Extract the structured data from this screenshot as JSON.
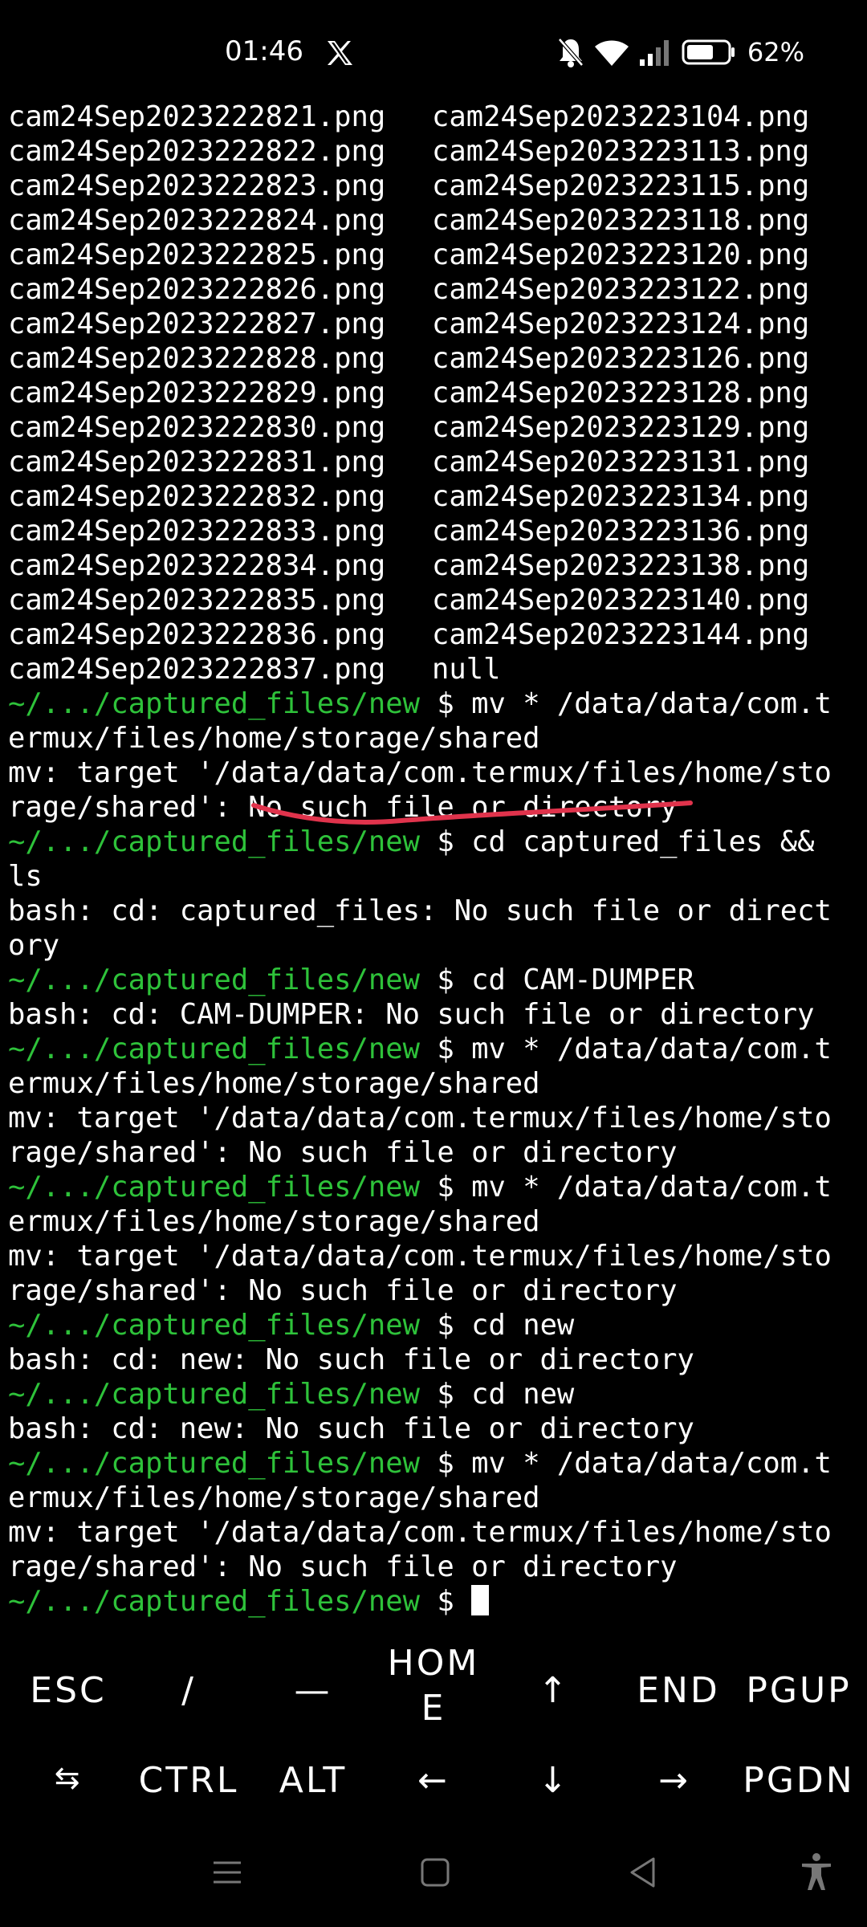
{
  "status_bar": {
    "time": "01:46",
    "battery_text": "62%",
    "icons": [
      "x-app-icon",
      "mute-icon",
      "wifi-icon",
      "signal-icon",
      "battery-icon"
    ]
  },
  "terminal": {
    "listing": [
      [
        "cam24Sep2023222821.png",
        "cam24Sep2023223104.png"
      ],
      [
        "cam24Sep2023222822.png",
        "cam24Sep2023223113.png"
      ],
      [
        "cam24Sep2023222823.png",
        "cam24Sep2023223115.png"
      ],
      [
        "cam24Sep2023222824.png",
        "cam24Sep2023223118.png"
      ],
      [
        "cam24Sep2023222825.png",
        "cam24Sep2023223120.png"
      ],
      [
        "cam24Sep2023222826.png",
        "cam24Sep2023223122.png"
      ],
      [
        "cam24Sep2023222827.png",
        "cam24Sep2023223124.png"
      ],
      [
        "cam24Sep2023222828.png",
        "cam24Sep2023223126.png"
      ],
      [
        "cam24Sep2023222829.png",
        "cam24Sep2023223128.png"
      ],
      [
        "cam24Sep2023222830.png",
        "cam24Sep2023223129.png"
      ],
      [
        "cam24Sep2023222831.png",
        "cam24Sep2023223131.png"
      ],
      [
        "cam24Sep2023222832.png",
        "cam24Sep2023223134.png"
      ],
      [
        "cam24Sep2023222833.png",
        "cam24Sep2023223136.png"
      ],
      [
        "cam24Sep2023222834.png",
        "cam24Sep2023223138.png"
      ],
      [
        "cam24Sep2023222835.png",
        "cam24Sep2023223140.png"
      ],
      [
        "cam24Sep2023222836.png",
        "cam24Sep2023223144.png"
      ],
      [
        "cam24Sep2023222837.png",
        "null"
      ]
    ],
    "prompt": "~/.../captured_files/new",
    "lines": [
      {
        "type": "cmd",
        "text": " $ mv * /data/data/com.t"
      },
      {
        "type": "out",
        "text": "ermux/files/home/storage/shared"
      },
      {
        "type": "out",
        "text": "mv: target '/data/data/com.termux/files/home/sto"
      },
      {
        "type": "out",
        "text": "rage/shared': No such file or directory"
      },
      {
        "type": "cmd",
        "text": " $ cd captured_files &&"
      },
      {
        "type": "out",
        "text": "ls"
      },
      {
        "type": "out",
        "text": "bash: cd: captured_files: No such file or direct"
      },
      {
        "type": "out",
        "text": "ory"
      },
      {
        "type": "cmd",
        "text": " $ cd CAM-DUMPER"
      },
      {
        "type": "out",
        "text": "bash: cd: CAM-DUMPER: No such file or directory"
      },
      {
        "type": "cmd",
        "text": " $ mv * /data/data/com.t"
      },
      {
        "type": "out",
        "text": "ermux/files/home/storage/shared"
      },
      {
        "type": "out",
        "text": "mv: target '/data/data/com.termux/files/home/sto"
      },
      {
        "type": "out",
        "text": "rage/shared': No such file or directory"
      },
      {
        "type": "cmd",
        "text": " $ mv * /data/data/com.t"
      },
      {
        "type": "out",
        "text": "ermux/files/home/storage/shared"
      },
      {
        "type": "out",
        "text": "mv: target '/data/data/com.termux/files/home/sto"
      },
      {
        "type": "out",
        "text": "rage/shared': No such file or directory"
      },
      {
        "type": "cmd",
        "text": " $ cd new"
      },
      {
        "type": "out",
        "text": "bash: cd: new: No such file or directory"
      },
      {
        "type": "cmd",
        "text": " $ cd new"
      },
      {
        "type": "out",
        "text": "bash: cd: new: No such file or directory"
      },
      {
        "type": "cmd",
        "text": " $ mv * /data/data/com.t"
      },
      {
        "type": "out",
        "text": "ermux/files/home/storage/shared"
      },
      {
        "type": "out",
        "text": "mv: target '/data/data/com.termux/files/home/sto"
      },
      {
        "type": "out",
        "text": "rage/shared': No such file or directory"
      }
    ],
    "final_prompt_suffix": " $ "
  },
  "extra_keys": {
    "row1": [
      "ESC",
      "/",
      "—",
      "HOM\nE",
      "↑",
      "END",
      "PGUP"
    ],
    "row2": [
      "⇆",
      "CTRL",
      "ALT",
      "←",
      "↓",
      "→",
      "PGDN"
    ]
  },
  "colors": {
    "prompt": "#2ec23a",
    "annotation": "#e0334c",
    "background": "#000000"
  },
  "nav_bar": {
    "icons": [
      "menu-icon",
      "home-icon",
      "back-icon",
      "accessibility-icon"
    ]
  }
}
